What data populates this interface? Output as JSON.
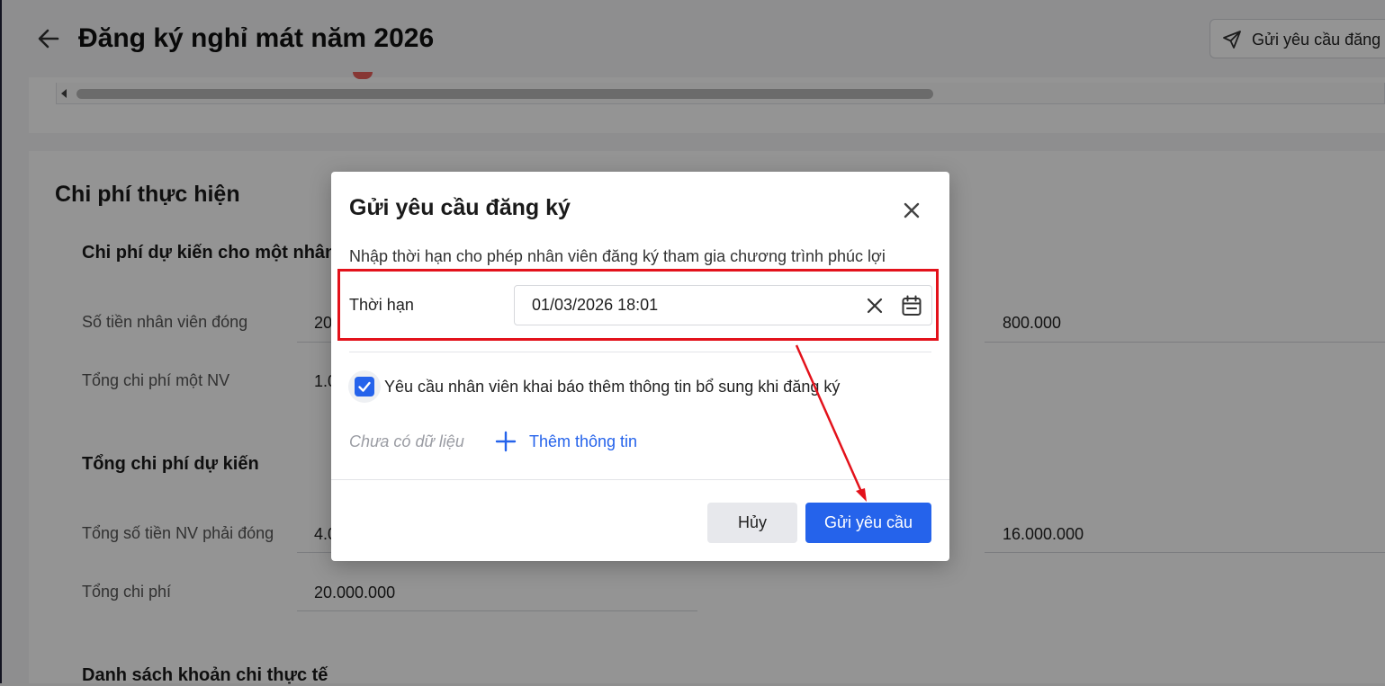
{
  "header": {
    "title": "Đăng ký nghỉ mát năm 2026",
    "send_button_label": "Gửi yêu cầu đăng"
  },
  "costs": {
    "section_title": "Chi phí thực hiện",
    "per_employee": {
      "title": "Chi phí dự kiến cho một nhân",
      "rows": [
        {
          "label": "Số tiền nhân viên đóng",
          "value": "20",
          "right_value": "800.000"
        },
        {
          "label": "Tổng chi phí một NV",
          "value": "1.0"
        }
      ]
    },
    "total": {
      "title": "Tổng chi phí dự kiến",
      "rows": [
        {
          "label": "Tổng số tiền NV phải đóng",
          "value": "4.0",
          "right_value": "16.000.000"
        },
        {
          "label": "Tổng chi phí",
          "value": "20.000.000"
        }
      ]
    },
    "actual_list_title": "Danh sách khoản chi thực tế"
  },
  "modal": {
    "title": "Gửi yêu cầu đăng ký",
    "description": "Nhập thời hạn cho phép nhân viên đăng ký tham gia chương trình phúc lợi",
    "deadline_label": "Thời hạn",
    "deadline_value": "01/03/2026 18:01",
    "checkbox_checked": true,
    "checkbox_label": "Yêu cầu nhân viên khai báo thêm thông tin bổ sung khi đăng ký",
    "empty_text": "Chưa có dữ liệu",
    "add_info_label": "Thêm thông tin",
    "cancel_label": "Hủy",
    "submit_label": "Gửi yêu cầu"
  },
  "colors": {
    "primary": "#2563eb",
    "highlight": "#e3121b"
  },
  "icons": [
    "back-arrow-icon",
    "send-icon",
    "close-icon",
    "clear-icon",
    "calendar-icon",
    "check-icon",
    "plus-icon"
  ]
}
